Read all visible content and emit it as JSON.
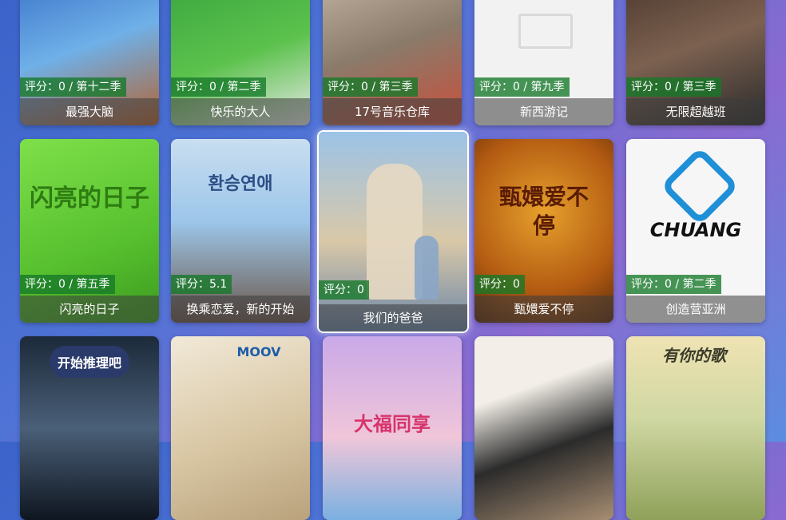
{
  "rows": [
    {
      "cards": [
        {
          "score": "评分：0 / 第十二季",
          "title": "最强大脑",
          "colors": [
            "#2a5fbf",
            "#6fb0e8",
            "#b5622e"
          ]
        },
        {
          "score": "评分：0 / 第二季",
          "title": "快乐的大人",
          "colors": [
            "#2e9c3a",
            "#5cc24d",
            "#e8e8e8"
          ]
        },
        {
          "score": "评分：0 / 第三季",
          "title": "17号音乐仓库",
          "colors": [
            "#d6c6b4",
            "#8a7b6b",
            "#c94f3b"
          ]
        },
        {
          "score": "评分：0 / 第九季",
          "title": "新西游记",
          "colors": [
            "#f2f2f2",
            "#e6e6e6",
            "#cfcfcf"
          ]
        },
        {
          "score": "评分：0 / 第三季",
          "title": "无限超越班",
          "colors": [
            "#3a2a22",
            "#7c6150",
            "#2b2b2b"
          ]
        }
      ]
    },
    {
      "cards": [
        {
          "score": "评分：0 / 第五季",
          "title": "闪亮的日子",
          "colors": [
            "#57c02e",
            "#7ee04a",
            "#3c9a1f"
          ],
          "art": "闪亮的日子"
        },
        {
          "score": "评分：5.1",
          "title": "换乘恋爱，新的开始",
          "colors": [
            "#9cc6ea",
            "#c9def0",
            "#6b5648"
          ],
          "art": "환승연애"
        },
        {
          "score": "评分：0",
          "title": "我们的爸爸",
          "colors": [
            "#9cc3e6",
            "#d9c8a8",
            "#6b86a6"
          ],
          "art": ""
        },
        {
          "score": "评分：0",
          "title": "甄嬛爱不停",
          "colors": [
            "#b35b12",
            "#e7a12c",
            "#5a2a0a"
          ],
          "art": "甄嬛爱不停"
        },
        {
          "score": "评分：0 / 第二季",
          "title": "创造营亚洲",
          "colors": [
            "#ffffff",
            "#f1f1f1",
            "#e3e3e3"
          ],
          "art": "CHUANG"
        }
      ]
    },
    {
      "cards": [
        {
          "colors": [
            "#1c2a3a",
            "#4a5f78",
            "#0f1620"
          ],
          "art": "开始推理吧"
        },
        {
          "colors": [
            "#f1e9d8",
            "#d8c6a3",
            "#b9a27c"
          ],
          "art": "MOOV"
        },
        {
          "colors": [
            "#c9a9e8",
            "#f0c6d9",
            "#7ab0e0"
          ],
          "art": "大福同享"
        },
        {
          "colors": [
            "#f3efe8",
            "#2b2b2b",
            "#a78d72"
          ],
          "art": ""
        },
        {
          "colors": [
            "#cfd7a2",
            "#8fa15a",
            "#efe3b3"
          ],
          "art": "有你的歌"
        }
      ]
    }
  ],
  "focused": {
    "row": 1,
    "col": 2
  }
}
